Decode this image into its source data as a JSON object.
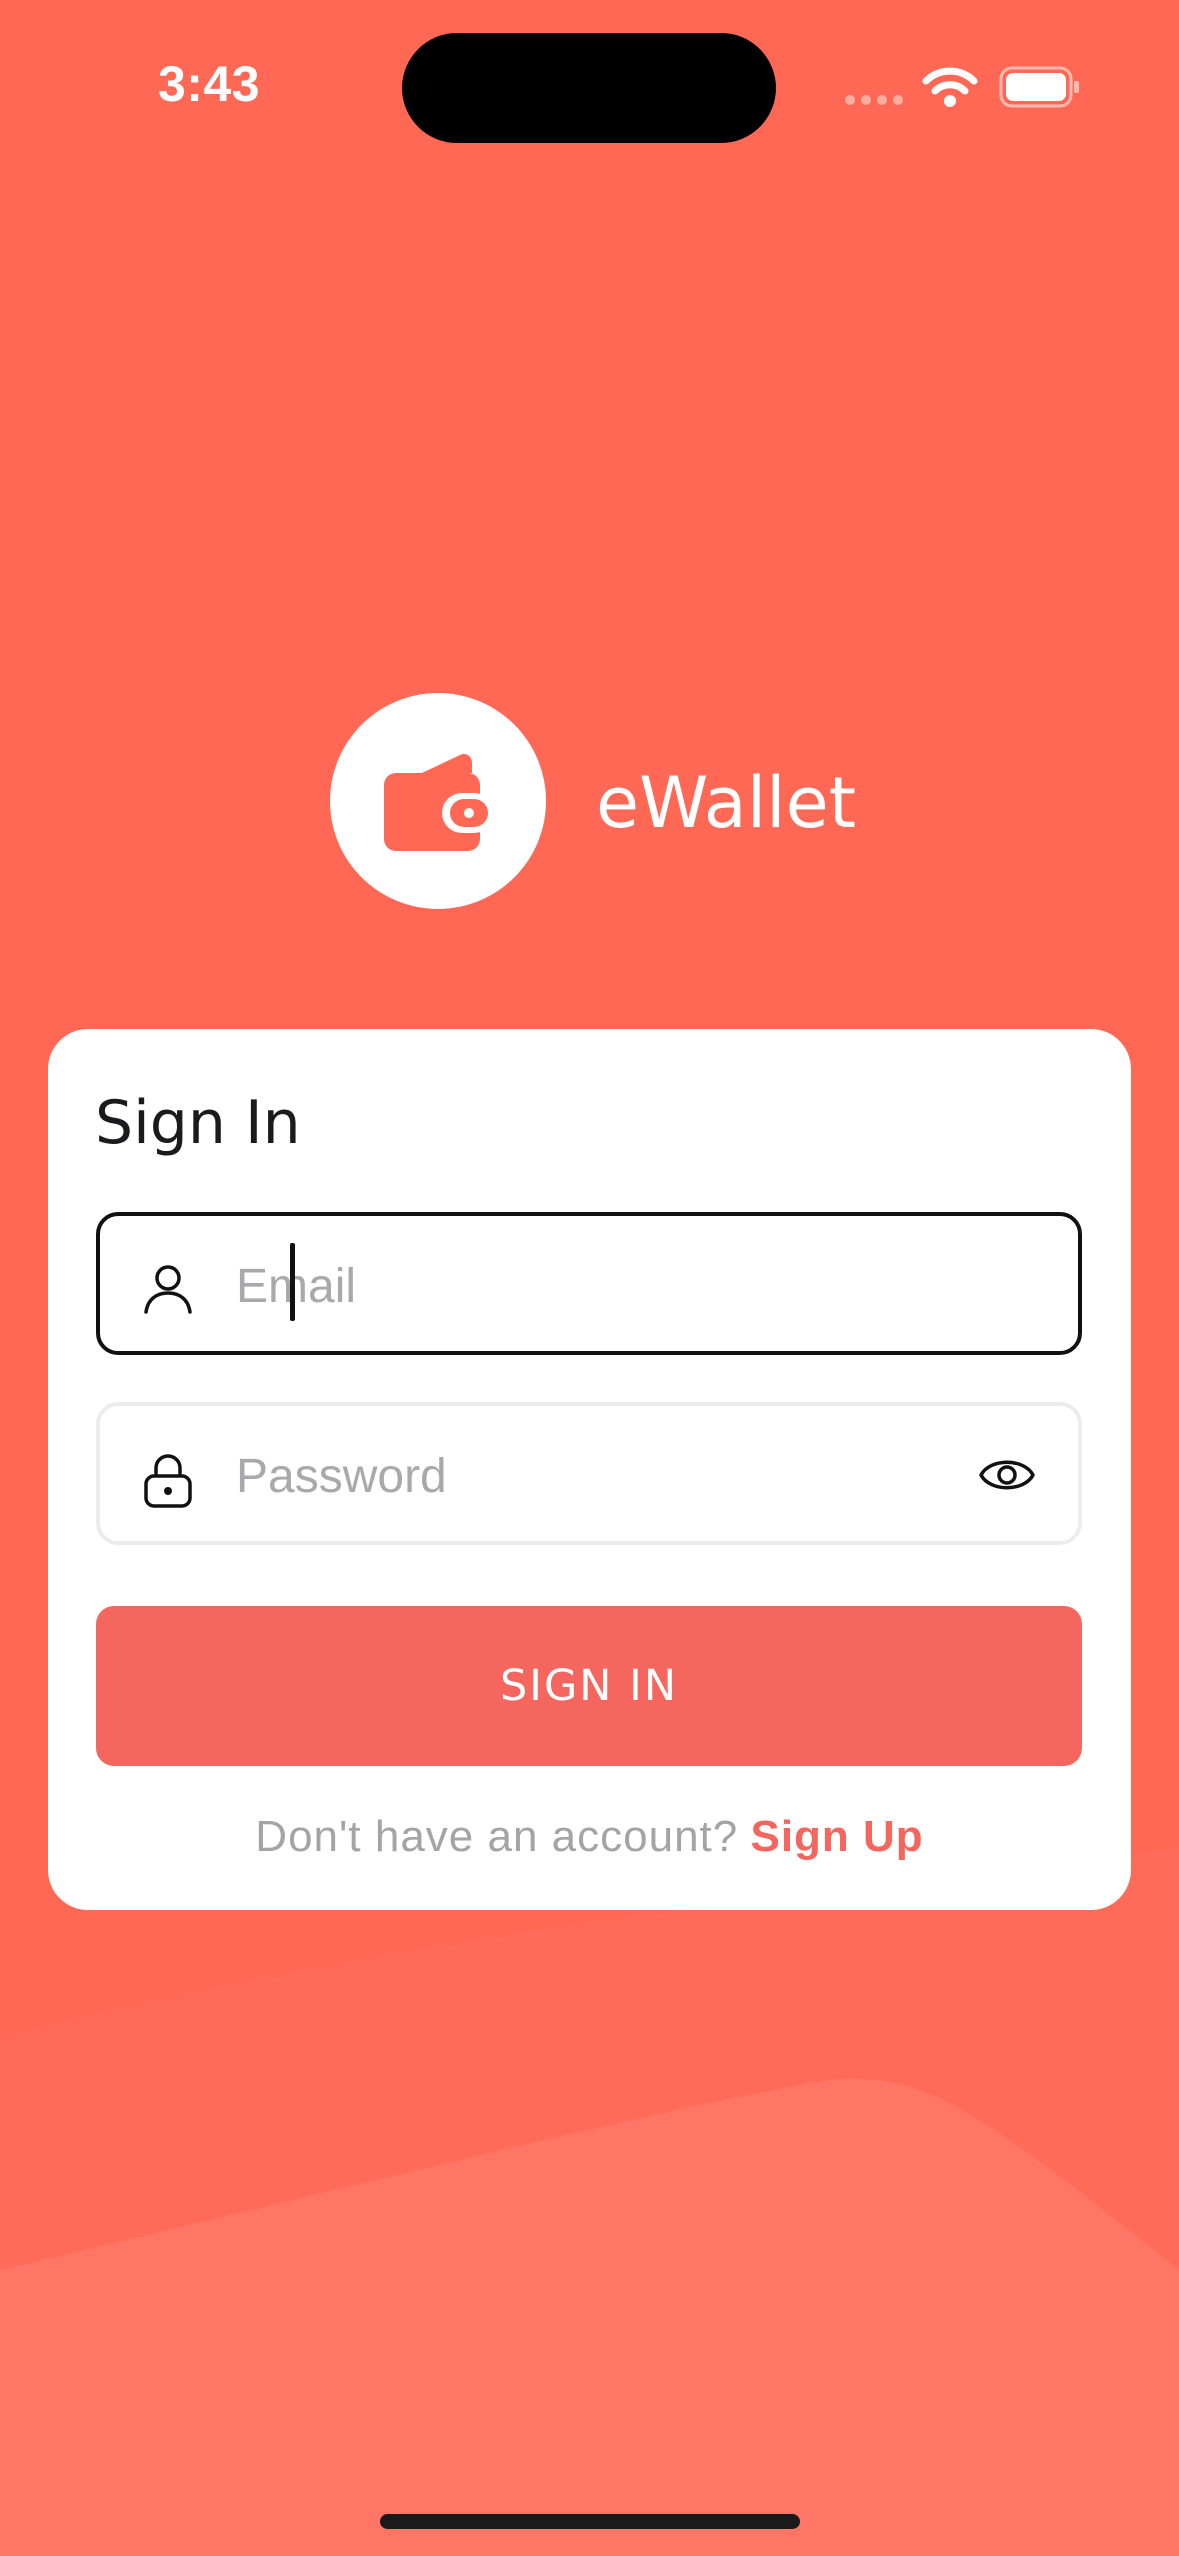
{
  "status_bar": {
    "time": "3:43"
  },
  "app": {
    "name": "eWallet",
    "logo_icon": "wallet-icon"
  },
  "signin_card": {
    "title": "Sign In",
    "email": {
      "placeholder": "Email",
      "value": "",
      "icon": "user-icon"
    },
    "password": {
      "placeholder": "Password",
      "value": "",
      "icon": "lock-icon",
      "toggle_icon": "eye-icon"
    },
    "submit_label": "SIGN IN",
    "signup_prompt": "Don't have an account?",
    "signup_link": "Sign Up"
  },
  "colors": {
    "background": "#FF6855",
    "accent": "#F4665E",
    "card": "#FFFFFF"
  }
}
